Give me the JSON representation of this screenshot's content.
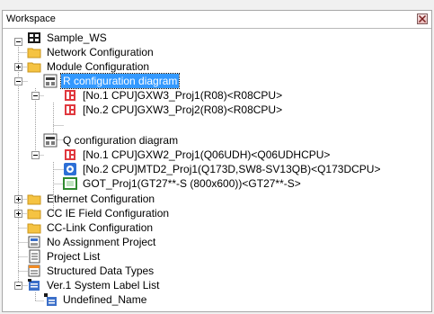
{
  "window": {
    "title": "Workspace",
    "close_icon": "close-icon"
  },
  "tree": {
    "root": {
      "label": "Sample_WS",
      "icon": "workspace-icon",
      "expanded": true
    },
    "network_configuration": {
      "label": "Network Configuration",
      "icon": "folder-icon",
      "expanded": false
    },
    "module_configuration": {
      "label": "Module Configuration",
      "icon": "folder-icon",
      "expanded": true
    },
    "r_configuration_diagram": {
      "label": "R configuration diagram",
      "icon": "configuration-diagram-icon",
      "expanded": true,
      "selected": true
    },
    "r_cpu_1": {
      "label": "[No.1 CPU]GXW3_Proj1(R08)<R08CPU>",
      "icon": "cpu-project-icon"
    },
    "r_cpu_2": {
      "label": "[No.2 CPU]GXW3_Proj2(R08)<R08CPU>",
      "icon": "cpu-project-icon"
    },
    "q_configuration_diagram": {
      "label": "Q configuration diagram",
      "icon": "configuration-diagram-icon",
      "expanded": true
    },
    "q_cpu_1": {
      "label": "[No.1 CPU]GXW2_Proj1(Q06UDH)<Q06UDHCPU>",
      "icon": "cpu-project-icon"
    },
    "q_cpu_2": {
      "label": "[No.2 CPU]MTD2_Proj1(Q173D,SW8-SV13QB)<Q173DCPU>",
      "icon": "motion-project-icon"
    },
    "got_proj": {
      "label": "GOT_Proj1(GT27**-S (800x600))<GT27**-S>",
      "icon": "got-project-icon"
    },
    "ethernet_configuration": {
      "label": "Ethernet Configuration",
      "icon": "folder-icon",
      "expanded": false
    },
    "cc_ie_field_configuration": {
      "label": "CC IE Field Configuration",
      "icon": "folder-icon",
      "expanded": false
    },
    "cc_link_configuration": {
      "label": "CC-Link Configuration",
      "icon": "folder-icon"
    },
    "no_assignment_project": {
      "label": "No Assignment Project",
      "icon": "no-assignment-project-icon"
    },
    "project_list": {
      "label": "Project List",
      "icon": "project-list-icon"
    },
    "structured_data_types": {
      "label": "Structured Data Types",
      "icon": "structured-data-types-icon"
    },
    "system_label_list": {
      "label": "Ver.1 System Label List",
      "icon": "system-label-list-icon",
      "expanded": true
    },
    "undefined_name": {
      "label": "Undefined_Name",
      "icon": "system-label-icon"
    }
  },
  "colors": {
    "selection": "#3399ff",
    "folder": "#f5c342",
    "cpu_red": "#e0383e",
    "motion_blue": "#2d6fd6",
    "got_green": "#2f8a2f"
  }
}
